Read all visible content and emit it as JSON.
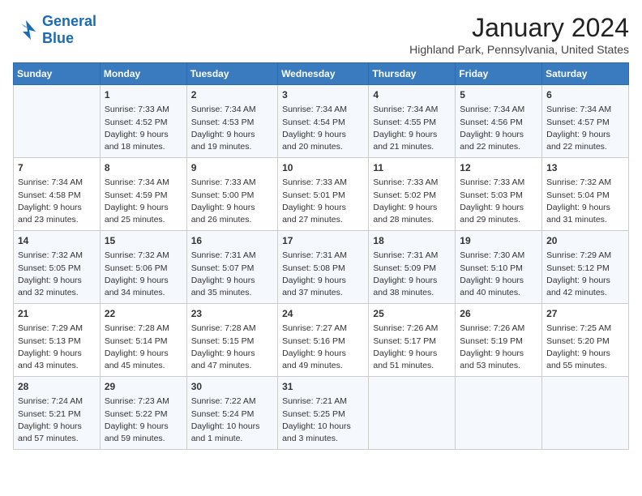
{
  "header": {
    "logo": {
      "line1": "General",
      "line2": "Blue"
    },
    "title": "January 2024",
    "location": "Highland Park, Pennsylvania, United States"
  },
  "days_of_week": [
    "Sunday",
    "Monday",
    "Tuesday",
    "Wednesday",
    "Thursday",
    "Friday",
    "Saturday"
  ],
  "weeks": [
    [
      {
        "day": "",
        "content": ""
      },
      {
        "day": "1",
        "content": "Sunrise: 7:33 AM\nSunset: 4:52 PM\nDaylight: 9 hours\nand 18 minutes."
      },
      {
        "day": "2",
        "content": "Sunrise: 7:34 AM\nSunset: 4:53 PM\nDaylight: 9 hours\nand 19 minutes."
      },
      {
        "day": "3",
        "content": "Sunrise: 7:34 AM\nSunset: 4:54 PM\nDaylight: 9 hours\nand 20 minutes."
      },
      {
        "day": "4",
        "content": "Sunrise: 7:34 AM\nSunset: 4:55 PM\nDaylight: 9 hours\nand 21 minutes."
      },
      {
        "day": "5",
        "content": "Sunrise: 7:34 AM\nSunset: 4:56 PM\nDaylight: 9 hours\nand 22 minutes."
      },
      {
        "day": "6",
        "content": "Sunrise: 7:34 AM\nSunset: 4:57 PM\nDaylight: 9 hours\nand 22 minutes."
      }
    ],
    [
      {
        "day": "7",
        "content": "Sunrise: 7:34 AM\nSunset: 4:58 PM\nDaylight: 9 hours\nand 23 minutes."
      },
      {
        "day": "8",
        "content": "Sunrise: 7:34 AM\nSunset: 4:59 PM\nDaylight: 9 hours\nand 25 minutes."
      },
      {
        "day": "9",
        "content": "Sunrise: 7:33 AM\nSunset: 5:00 PM\nDaylight: 9 hours\nand 26 minutes."
      },
      {
        "day": "10",
        "content": "Sunrise: 7:33 AM\nSunset: 5:01 PM\nDaylight: 9 hours\nand 27 minutes."
      },
      {
        "day": "11",
        "content": "Sunrise: 7:33 AM\nSunset: 5:02 PM\nDaylight: 9 hours\nand 28 minutes."
      },
      {
        "day": "12",
        "content": "Sunrise: 7:33 AM\nSunset: 5:03 PM\nDaylight: 9 hours\nand 29 minutes."
      },
      {
        "day": "13",
        "content": "Sunrise: 7:32 AM\nSunset: 5:04 PM\nDaylight: 9 hours\nand 31 minutes."
      }
    ],
    [
      {
        "day": "14",
        "content": "Sunrise: 7:32 AM\nSunset: 5:05 PM\nDaylight: 9 hours\nand 32 minutes."
      },
      {
        "day": "15",
        "content": "Sunrise: 7:32 AM\nSunset: 5:06 PM\nDaylight: 9 hours\nand 34 minutes."
      },
      {
        "day": "16",
        "content": "Sunrise: 7:31 AM\nSunset: 5:07 PM\nDaylight: 9 hours\nand 35 minutes."
      },
      {
        "day": "17",
        "content": "Sunrise: 7:31 AM\nSunset: 5:08 PM\nDaylight: 9 hours\nand 37 minutes."
      },
      {
        "day": "18",
        "content": "Sunrise: 7:31 AM\nSunset: 5:09 PM\nDaylight: 9 hours\nand 38 minutes."
      },
      {
        "day": "19",
        "content": "Sunrise: 7:30 AM\nSunset: 5:10 PM\nDaylight: 9 hours\nand 40 minutes."
      },
      {
        "day": "20",
        "content": "Sunrise: 7:29 AM\nSunset: 5:12 PM\nDaylight: 9 hours\nand 42 minutes."
      }
    ],
    [
      {
        "day": "21",
        "content": "Sunrise: 7:29 AM\nSunset: 5:13 PM\nDaylight: 9 hours\nand 43 minutes."
      },
      {
        "day": "22",
        "content": "Sunrise: 7:28 AM\nSunset: 5:14 PM\nDaylight: 9 hours\nand 45 minutes."
      },
      {
        "day": "23",
        "content": "Sunrise: 7:28 AM\nSunset: 5:15 PM\nDaylight: 9 hours\nand 47 minutes."
      },
      {
        "day": "24",
        "content": "Sunrise: 7:27 AM\nSunset: 5:16 PM\nDaylight: 9 hours\nand 49 minutes."
      },
      {
        "day": "25",
        "content": "Sunrise: 7:26 AM\nSunset: 5:17 PM\nDaylight: 9 hours\nand 51 minutes."
      },
      {
        "day": "26",
        "content": "Sunrise: 7:26 AM\nSunset: 5:19 PM\nDaylight: 9 hours\nand 53 minutes."
      },
      {
        "day": "27",
        "content": "Sunrise: 7:25 AM\nSunset: 5:20 PM\nDaylight: 9 hours\nand 55 minutes."
      }
    ],
    [
      {
        "day": "28",
        "content": "Sunrise: 7:24 AM\nSunset: 5:21 PM\nDaylight: 9 hours\nand 57 minutes."
      },
      {
        "day": "29",
        "content": "Sunrise: 7:23 AM\nSunset: 5:22 PM\nDaylight: 9 hours\nand 59 minutes."
      },
      {
        "day": "30",
        "content": "Sunrise: 7:22 AM\nSunset: 5:24 PM\nDaylight: 10 hours\nand 1 minute."
      },
      {
        "day": "31",
        "content": "Sunrise: 7:21 AM\nSunset: 5:25 PM\nDaylight: 10 hours\nand 3 minutes."
      },
      {
        "day": "",
        "content": ""
      },
      {
        "day": "",
        "content": ""
      },
      {
        "day": "",
        "content": ""
      }
    ]
  ]
}
